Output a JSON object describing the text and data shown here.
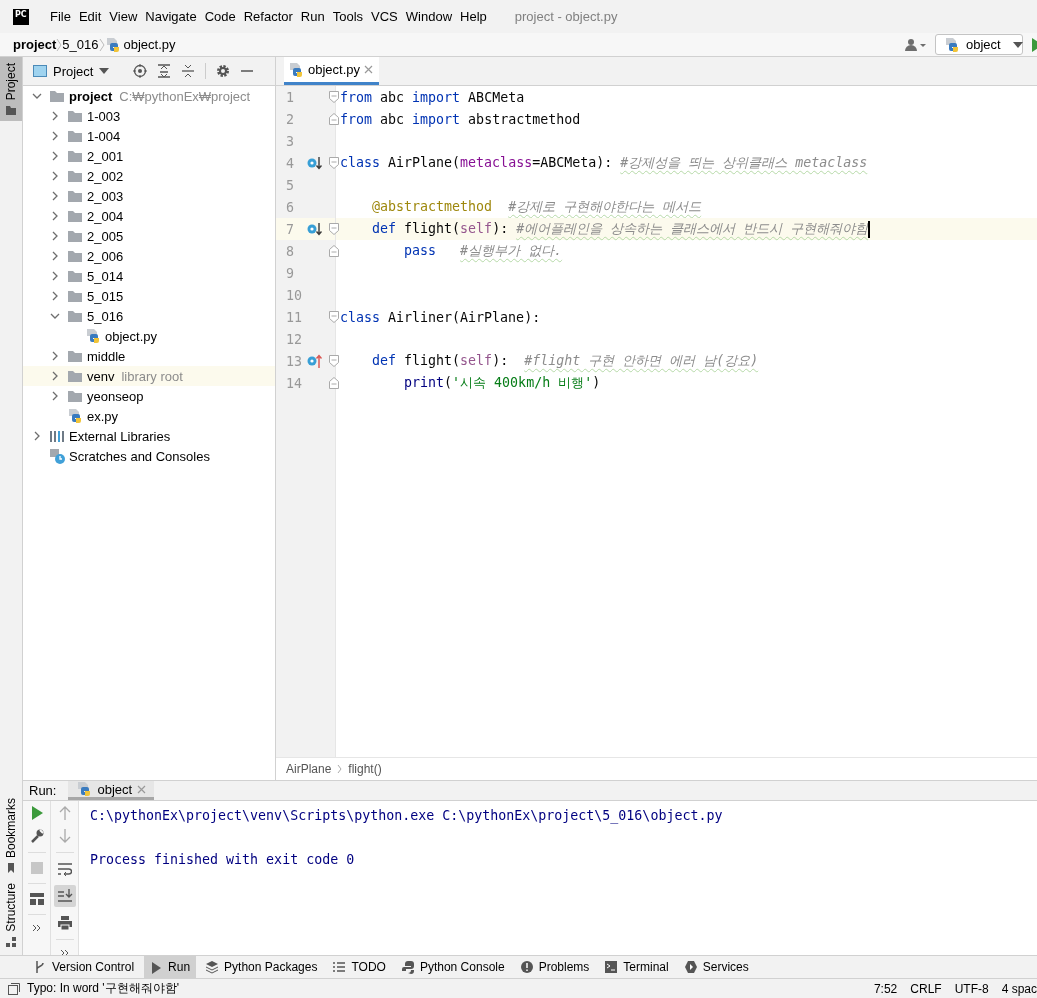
{
  "menubar": {
    "logo": "PC",
    "items": [
      "File",
      "Edit",
      "View",
      "Navigate",
      "Code",
      "Refactor",
      "Run",
      "Tools",
      "VCS",
      "Window",
      "Help"
    ],
    "title": "project - object.py"
  },
  "navbar": {
    "breadcrumbs": [
      {
        "label": "project",
        "kind": "root"
      },
      {
        "label": "5_016",
        "kind": "folder"
      },
      {
        "label": "object.py",
        "kind": "python"
      }
    ],
    "run_config": "object"
  },
  "side_stripe": {
    "top": [
      {
        "label": "Project",
        "selected": true
      }
    ],
    "bottom": [
      {
        "label": "Bookmarks",
        "selected": false
      },
      {
        "label": "Structure",
        "selected": false
      }
    ]
  },
  "project_panel": {
    "title": "Project",
    "tree": [
      {
        "label": "project",
        "hint": "C:₩pythonEx₩project",
        "kind": "root",
        "expanded": true,
        "highlighted": false,
        "children": [
          {
            "label": "1-003",
            "kind": "folder",
            "expanded": false,
            "highlighted": false
          },
          {
            "label": "1-004",
            "kind": "folder",
            "expanded": false,
            "highlighted": false
          },
          {
            "label": "2_001",
            "kind": "folder",
            "expanded": false,
            "highlighted": false
          },
          {
            "label": "2_002",
            "kind": "folder",
            "expanded": false,
            "highlighted": false
          },
          {
            "label": "2_003",
            "kind": "folder",
            "expanded": false,
            "highlighted": false
          },
          {
            "label": "2_004",
            "kind": "folder",
            "expanded": false,
            "highlighted": false
          },
          {
            "label": "2_005",
            "kind": "folder",
            "expanded": false,
            "highlighted": false
          },
          {
            "label": "2_006",
            "kind": "folder",
            "expanded": false,
            "highlighted": false
          },
          {
            "label": "5_014",
            "kind": "folder",
            "expanded": false,
            "highlighted": false
          },
          {
            "label": "5_015",
            "kind": "folder",
            "expanded": false,
            "highlighted": false
          },
          {
            "label": "5_016",
            "kind": "folder",
            "expanded": true,
            "highlighted": false,
            "children": [
              {
                "label": "object.py",
                "kind": "python",
                "highlighted": false
              }
            ]
          },
          {
            "label": "middle",
            "kind": "folder",
            "expanded": false,
            "highlighted": false
          },
          {
            "label": "venv",
            "hint": "library root",
            "kind": "folder",
            "expanded": false,
            "highlighted": true
          },
          {
            "label": "yeonseop",
            "kind": "folder",
            "expanded": false,
            "highlighted": false
          },
          {
            "label": "ex.py",
            "kind": "python",
            "highlighted": false
          }
        ]
      },
      {
        "label": "External Libraries",
        "kind": "libraries",
        "expanded": false,
        "highlighted": false
      },
      {
        "label": "Scratches and Consoles",
        "kind": "scratches",
        "highlighted": false
      }
    ]
  },
  "editor": {
    "tabs": [
      {
        "label": "object.py",
        "selected": true
      }
    ],
    "lines": [
      {
        "number": "1",
        "fold": {
          "kind": "start"
        },
        "current": false,
        "tokens": [
          {
            "kind": "keyword",
            "text": "from"
          },
          {
            "kind": "plain",
            "text": " abc "
          },
          {
            "kind": "keyword",
            "text": "import"
          },
          {
            "kind": "plain",
            "text": " ABCMeta"
          }
        ]
      },
      {
        "number": "2",
        "fold": {
          "kind": "end"
        },
        "current": false,
        "tokens": [
          {
            "kind": "keyword",
            "text": "from"
          },
          {
            "kind": "plain",
            "text": " abc "
          },
          {
            "kind": "keyword",
            "text": "import"
          },
          {
            "kind": "plain",
            "text": " abstractmethod"
          }
        ]
      },
      {
        "number": "3",
        "current": false
      },
      {
        "number": "4",
        "marker": {
          "kind": "implemented"
        },
        "fold": {
          "kind": "start"
        },
        "current": false,
        "tokens": [
          {
            "kind": "keyword",
            "text": "class"
          },
          {
            "kind": "plain",
            "text": " AirPlane("
          },
          {
            "kind": "param",
            "text": "metaclass"
          },
          {
            "kind": "plain",
            "text": "=ABCMeta): "
          },
          {
            "kind": "comment",
            "text": "#강제성을 띄는 상위클래스 metaclass"
          }
        ]
      },
      {
        "number": "5",
        "current": false
      },
      {
        "number": "6",
        "current": false,
        "tokens": [
          {
            "kind": "decorator",
            "text": "    @abstractmethod  "
          },
          {
            "kind": "comment",
            "text": "#강제로 구현해야한다는 메서드"
          }
        ]
      },
      {
        "number": "7",
        "marker": {
          "kind": "implemented"
        },
        "fold": {
          "kind": "start"
        },
        "current": true,
        "tokens": [
          {
            "kind": "keyword",
            "text": "    def"
          },
          {
            "kind": "plain",
            "text": " flight("
          },
          {
            "kind": "self",
            "text": "self"
          },
          {
            "kind": "plain",
            "text": "): "
          },
          {
            "kind": "comment",
            "text": "#에어플레인을 상속하는 클래스에서 반드시 구현해줘야함"
          }
        ]
      },
      {
        "number": "8",
        "fold": {
          "kind": "end"
        },
        "current": false,
        "tokens": [
          {
            "kind": "keyword",
            "text": "        pass   "
          },
          {
            "kind": "comment",
            "text": "#실행부가 없다."
          }
        ]
      },
      {
        "number": "9",
        "current": false
      },
      {
        "number": "10",
        "current": false
      },
      {
        "number": "11",
        "fold": {
          "kind": "start"
        },
        "current": false,
        "tokens": [
          {
            "kind": "keyword",
            "text": "class"
          },
          {
            "kind": "plain",
            "text": " Airliner(AirPlane):"
          }
        ]
      },
      {
        "number": "12",
        "current": false
      },
      {
        "number": "13",
        "marker": {
          "kind": "overriding"
        },
        "fold": {
          "kind": "start"
        },
        "current": false,
        "tokens": [
          {
            "kind": "keyword",
            "text": "    def"
          },
          {
            "kind": "plain",
            "text": " flight("
          },
          {
            "kind": "self",
            "text": "self"
          },
          {
            "kind": "plain",
            "text": "):  "
          },
          {
            "kind": "comment",
            "text": "#flight 구현 안하면 에러 남(강요)"
          }
        ]
      },
      {
        "number": "14",
        "fold": {
          "kind": "end"
        },
        "current": false,
        "tokens": [
          {
            "kind": "builtin",
            "text": "        print"
          },
          {
            "kind": "plain",
            "text": "("
          },
          {
            "kind": "string",
            "text": "'시속 400km/h 비행'"
          },
          {
            "kind": "plain",
            "text": ")"
          }
        ]
      }
    ],
    "breadcrumbs": [
      "AirPlane",
      "flight()"
    ]
  },
  "run_panel": {
    "label": "Run:",
    "tabs": [
      {
        "label": "object",
        "selected": true
      }
    ],
    "output": [
      "C:\\pythonEx\\project\\venv\\Scripts\\python.exe C:\\pythonEx\\project\\5_016\\object.py",
      "Process finished with exit code 0"
    ]
  },
  "tool_windows": [
    {
      "label": "Version Control",
      "kind": "vcs",
      "selected": false
    },
    {
      "label": "Run",
      "kind": "run",
      "selected": true
    },
    {
      "label": "Python Packages",
      "kind": "packages",
      "selected": false
    },
    {
      "label": "TODO",
      "kind": "todo",
      "selected": false
    },
    {
      "label": "Python Console",
      "kind": "console",
      "selected": false
    },
    {
      "label": "Problems",
      "kind": "problems",
      "selected": false
    },
    {
      "label": "Terminal",
      "kind": "terminal",
      "selected": false
    },
    {
      "label": "Services",
      "kind": "services",
      "selected": false
    }
  ],
  "status_bar": {
    "message": "Typo: In word '구현해줘야함'",
    "items": [
      "7:52",
      "CRLF",
      "UTF-8",
      "4 spac"
    ]
  }
}
